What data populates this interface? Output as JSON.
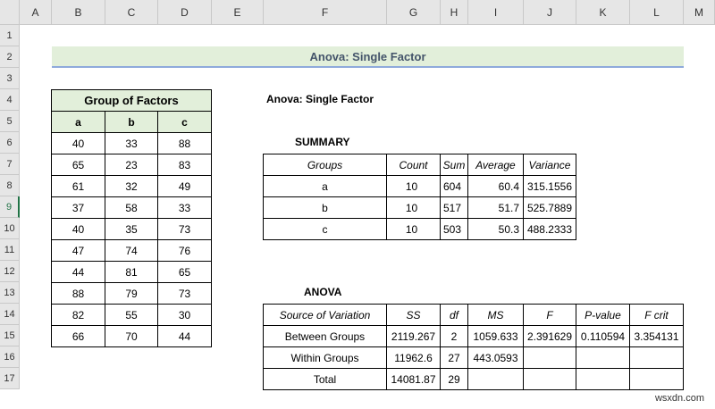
{
  "columns": [
    "A",
    "B",
    "C",
    "D",
    "E",
    "F",
    "G",
    "H",
    "I",
    "J",
    "K",
    "L",
    "M"
  ],
  "rows": [
    "1",
    "2",
    "3",
    "4",
    "5",
    "6",
    "7",
    "8",
    "9",
    "10",
    "11",
    "12",
    "13",
    "14",
    "15",
    "16",
    "17"
  ],
  "selected_row": "9",
  "title": "Anova: Single Factor",
  "factors": {
    "header": "Group of Factors",
    "cols": [
      "a",
      "b",
      "c"
    ],
    "values": [
      [
        "40",
        "33",
        "88"
      ],
      [
        "65",
        "23",
        "83"
      ],
      [
        "61",
        "32",
        "49"
      ],
      [
        "37",
        "58",
        "33"
      ],
      [
        "40",
        "35",
        "73"
      ],
      [
        "47",
        "74",
        "76"
      ],
      [
        "44",
        "81",
        "65"
      ],
      [
        "88",
        "79",
        "73"
      ],
      [
        "82",
        "55",
        "30"
      ],
      [
        "66",
        "70",
        "44"
      ]
    ]
  },
  "anova_label": "Anova: Single Factor",
  "summary": {
    "label": "SUMMARY",
    "headers": [
      "Groups",
      "Count",
      "Sum",
      "Average",
      "Variance"
    ],
    "rows": [
      [
        "a",
        "10",
        "604",
        "60.4",
        "315.1556"
      ],
      [
        "b",
        "10",
        "517",
        "51.7",
        "525.7889"
      ],
      [
        "c",
        "10",
        "503",
        "50.3",
        "488.2333"
      ]
    ]
  },
  "anova": {
    "label": "ANOVA",
    "headers": [
      "Source of Variation",
      "SS",
      "df",
      "MS",
      "F",
      "P-value",
      "F crit"
    ],
    "rows": [
      [
        "Between Groups",
        "2119.267",
        "2",
        "1059.633",
        "2.391629",
        "0.110594",
        "3.354131"
      ],
      [
        "Within Groups",
        "11962.6",
        "27",
        "443.0593",
        "",
        "",
        ""
      ],
      [
        "Total",
        "14081.87",
        "29",
        "",
        "",
        "",
        ""
      ]
    ]
  },
  "watermark": "wsxdn.com"
}
